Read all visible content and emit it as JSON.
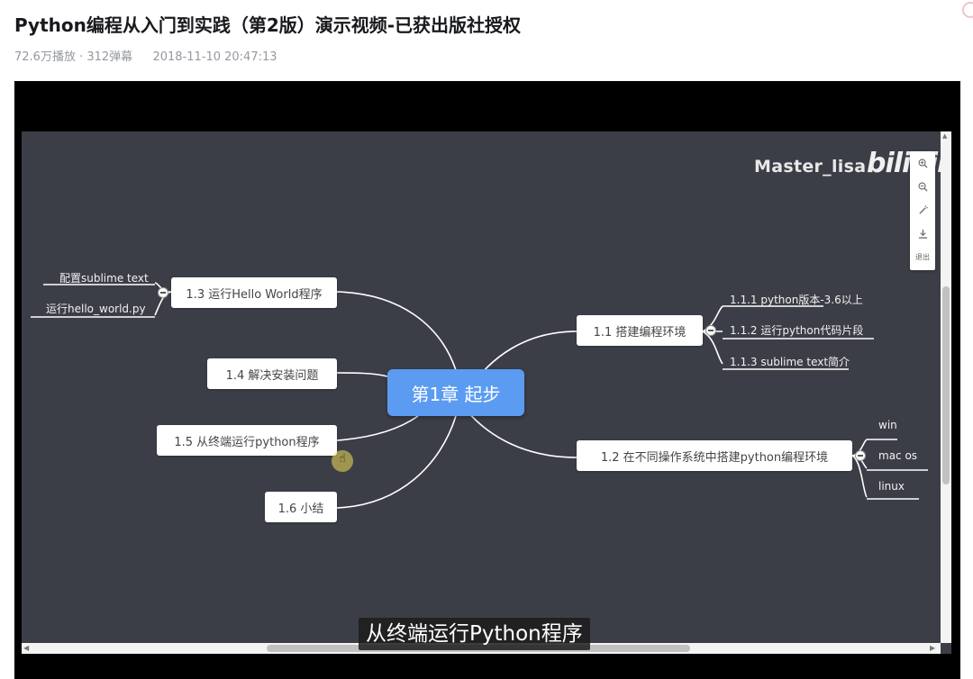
{
  "video": {
    "title": "Python编程从入门到实践（第2版）演示视频-已获出版社授权",
    "views": "72.6万播放 · 312弹幕",
    "date": "2018-11-10 20:47:13"
  },
  "mindmap": {
    "root": "第1章 起步",
    "right": {
      "b11": {
        "label": "1.1 搭建编程环境",
        "children": [
          "1.1.1 python版本-3.6以上",
          "1.1.2 运行python代码片段",
          "1.1.3 sublime text简介"
        ]
      },
      "b12": {
        "label": "1.2 在不同操作系统中搭建python编程环境",
        "children": [
          "win",
          "mac os",
          "linux"
        ]
      }
    },
    "left": {
      "b13": {
        "label": "1.3 运行Hello World程序",
        "children": [
          "配置sublime text",
          "运行hello_world.py"
        ]
      },
      "b14": {
        "label": "1.4 解决安装问题"
      },
      "b15": {
        "label": "1.5 从终端运行python程序"
      },
      "b16": {
        "label": "1.6 小结"
      }
    }
  },
  "watermark": {
    "author": "Master_lisa",
    "logo": "bilibili"
  },
  "toolbar": {
    "exit": "退出"
  },
  "icons": {
    "zoom_in": "zoom-in-icon",
    "zoom_out": "zoom-out-icon",
    "fit": "magic-wand-icon",
    "download": "download-icon"
  },
  "subtitle": "从终端运行Python程序",
  "colors": {
    "canvas": "#3c3e47",
    "root": "#5b9cf2",
    "line": "#ffffff"
  }
}
